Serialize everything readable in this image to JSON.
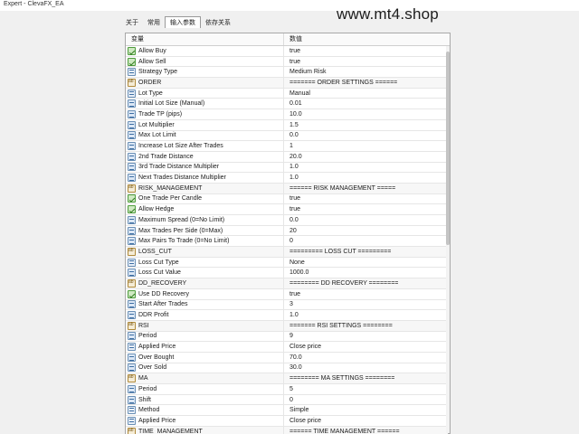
{
  "window": {
    "title": "Expert - ClevaFX_EA"
  },
  "watermark": "www.mt4.shop",
  "tabs": [
    {
      "label": "关于",
      "active": false
    },
    {
      "label": "常用",
      "active": false
    },
    {
      "label": "输入参数",
      "active": true
    },
    {
      "label": "依存关系",
      "active": false
    }
  ],
  "table": {
    "headers": {
      "name": "变量",
      "value": "数值"
    },
    "rows": [
      {
        "icon": "bool",
        "name": "Allow Buy",
        "value": "true"
      },
      {
        "icon": "bool",
        "name": "Allow Sell",
        "value": "true"
      },
      {
        "icon": "enum",
        "name": "Strategy Type",
        "value": "Medium Risk"
      },
      {
        "icon": "text",
        "name": "ORDER",
        "value": "======= ORDER SETTINGS ======"
      },
      {
        "icon": "enum",
        "name": "Lot Type",
        "value": "Manual"
      },
      {
        "icon": "num",
        "name": "Initial Lot Size (Manual)",
        "value": "0.01"
      },
      {
        "icon": "num",
        "name": "Trade TP (pips)",
        "value": "10.0"
      },
      {
        "icon": "num",
        "name": "Lot Multiplier",
        "value": "1.5"
      },
      {
        "icon": "num",
        "name": "Max Lot Limit",
        "value": "0.0"
      },
      {
        "icon": "num",
        "name": "Increase Lot Size After Trades",
        "value": "1"
      },
      {
        "icon": "num",
        "name": "2nd Trade Distance",
        "value": "20.0"
      },
      {
        "icon": "num",
        "name": "3rd Trade Distance Multiplier",
        "value": "1.0"
      },
      {
        "icon": "num",
        "name": "Next Trades Distance Multiplier",
        "value": "1.0"
      },
      {
        "icon": "text",
        "name": "RISK_MANAGEMENT",
        "value": "====== RISK MANAGEMENT ====="
      },
      {
        "icon": "bool",
        "name": "One Trade Per Candle",
        "value": "true"
      },
      {
        "icon": "bool",
        "name": "Allow Hedge",
        "value": "true"
      },
      {
        "icon": "num",
        "name": "Maximum Spread (0=No Limit)",
        "value": "0.0"
      },
      {
        "icon": "num",
        "name": "Max Trades Per Side (0=Max)",
        "value": "20"
      },
      {
        "icon": "num",
        "name": "Max Pairs To Trade (0=No Limit)",
        "value": "0"
      },
      {
        "icon": "text",
        "name": "LOSS_CUT",
        "value": "========= LOSS CUT ========="
      },
      {
        "icon": "enum",
        "name": "Loss Cut Type",
        "value": "None"
      },
      {
        "icon": "num",
        "name": "Loss Cut Value",
        "value": "1000.0"
      },
      {
        "icon": "text",
        "name": "DD_RECOVERY",
        "value": "======== DD RECOVERY ========"
      },
      {
        "icon": "bool",
        "name": "Use DD Recovery",
        "value": "true"
      },
      {
        "icon": "num",
        "name": "Start After Trades",
        "value": "3"
      },
      {
        "icon": "num",
        "name": "DDR Profit",
        "value": "1.0"
      },
      {
        "icon": "text",
        "name": "RSI",
        "value": "======= RSI SETTINGS ========"
      },
      {
        "icon": "num",
        "name": "Period",
        "value": "9"
      },
      {
        "icon": "enum",
        "name": "Applied Price",
        "value": "Close price"
      },
      {
        "icon": "num",
        "name": "Over Bought",
        "value": "70.0"
      },
      {
        "icon": "num",
        "name": "Over Sold",
        "value": "30.0"
      },
      {
        "icon": "text",
        "name": "MA",
        "value": "======== MA SETTINGS ========"
      },
      {
        "icon": "num",
        "name": "Period",
        "value": "5"
      },
      {
        "icon": "num",
        "name": "Shift",
        "value": "0"
      },
      {
        "icon": "enum",
        "name": "Method",
        "value": "Simple"
      },
      {
        "icon": "enum",
        "name": "Applied Price",
        "value": "Close price"
      },
      {
        "icon": "text",
        "name": "TIME_MANAGEMENT",
        "value": "====== TIME MANAGEMENT ======"
      }
    ]
  }
}
